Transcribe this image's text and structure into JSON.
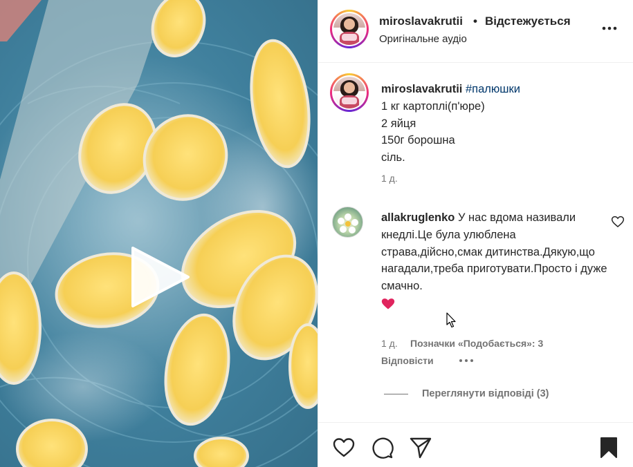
{
  "post": {
    "media": {
      "type": "video",
      "description_icon": "play-icon"
    },
    "header": {
      "username": "miroslavakrutii",
      "separator": "•",
      "follow_status": "Відстежується",
      "audio": "Оригінальне аудіо",
      "more_icon": "more-horizontal-icon"
    },
    "caption": {
      "username": "miroslavakrutii",
      "hashtag": "#палюшки",
      "lines": [
        "1 кг картоплі(п'юре)",
        "2 яйця",
        "150г борошна",
        "сіль."
      ],
      "time": "1 д."
    },
    "comment": {
      "username": "allakruglenko",
      "text": "У нас вдома називали кнедлі.Це була улюблена страва,дійсно,смак дитинства.Дякую,що нагадали,треба приготувати.Просто і дуже смачно.",
      "emoji": "heart-emoji",
      "time": "1 д.",
      "likes_label": "Позначки «Подобається»: 3",
      "reply_label": "Відповісти",
      "view_replies": "Переглянути відповіді (3)"
    },
    "actions": {
      "like_icon": "heart-icon",
      "comment_icon": "comment-icon",
      "share_icon": "send-icon",
      "save_icon": "bookmark-icon"
    }
  },
  "colors": {
    "text": "#262626",
    "secondary": "#737373",
    "hashtag": "#00376b",
    "divider": "#efefef",
    "heart_emoji": "#e0245e"
  }
}
